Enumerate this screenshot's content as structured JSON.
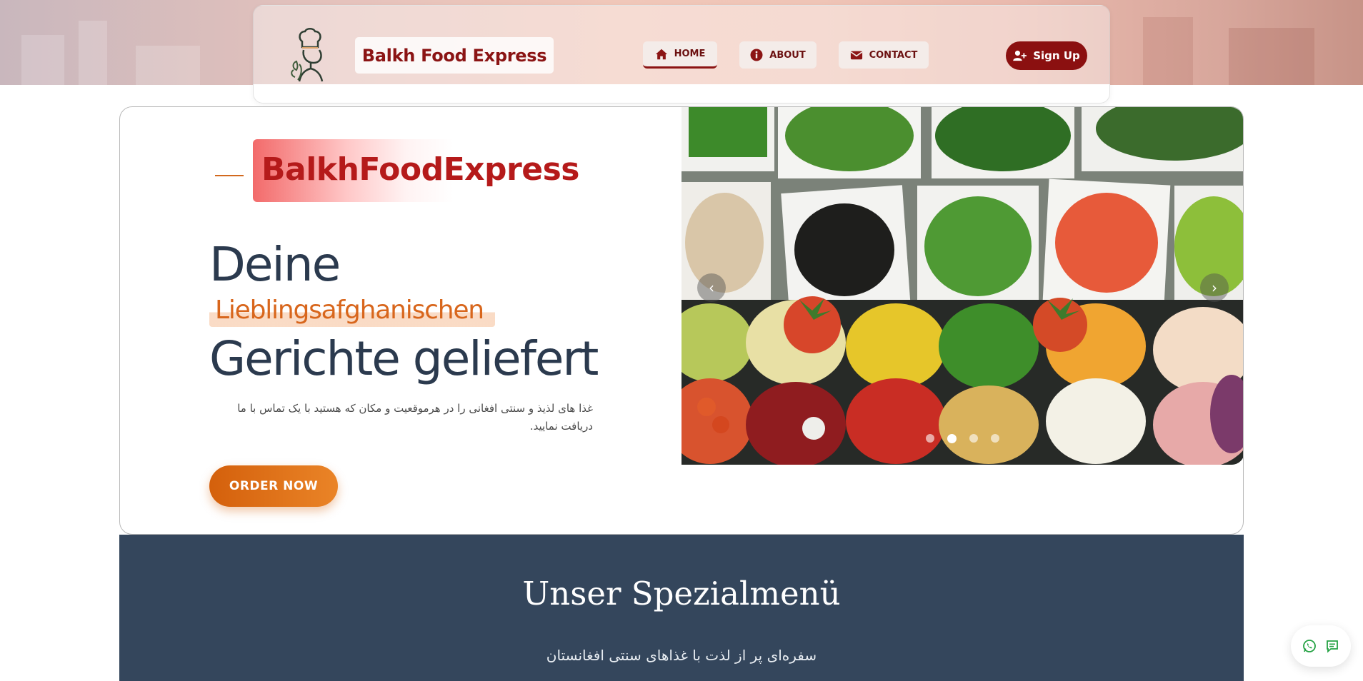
{
  "header": {
    "brand": "Balkh Food Express",
    "nav": [
      {
        "label": "HOME",
        "icon": "home-icon",
        "active": true
      },
      {
        "label": "ABOUT",
        "icon": "info-icon",
        "active": false
      },
      {
        "label": "CONTACT",
        "icon": "envelope-icon",
        "active": false
      }
    ],
    "signup_label": "Sign Up"
  },
  "hero": {
    "brand_tag": "BalkhFoodExpress",
    "headline_line1": "Deine",
    "headline_line2": "Lieblingsafghanischen",
    "headline_line3": "Gerichte geliefert",
    "description": "غذا های لذیذ و سنتی افغانی را در هرموقعیت و مکان که هستید با یک تماس با ما دریافت نمایید.",
    "cta_label": "ORDER NOW"
  },
  "carousel": {
    "prev_glyph": "‹",
    "next_glyph": "›",
    "slide_count": 4,
    "active_slide": 2
  },
  "menu": {
    "title": "Unser Spezialmenü",
    "subtitle": "سفره‌ای پر از لذت با غذاهای سنتی افغانستان"
  },
  "colors": {
    "brand_red": "#8b1414",
    "accent_orange": "#d8661c",
    "heading_navy": "#2b3a4e",
    "menu_bg": "#34465c",
    "whatsapp_green": "#25a244"
  }
}
